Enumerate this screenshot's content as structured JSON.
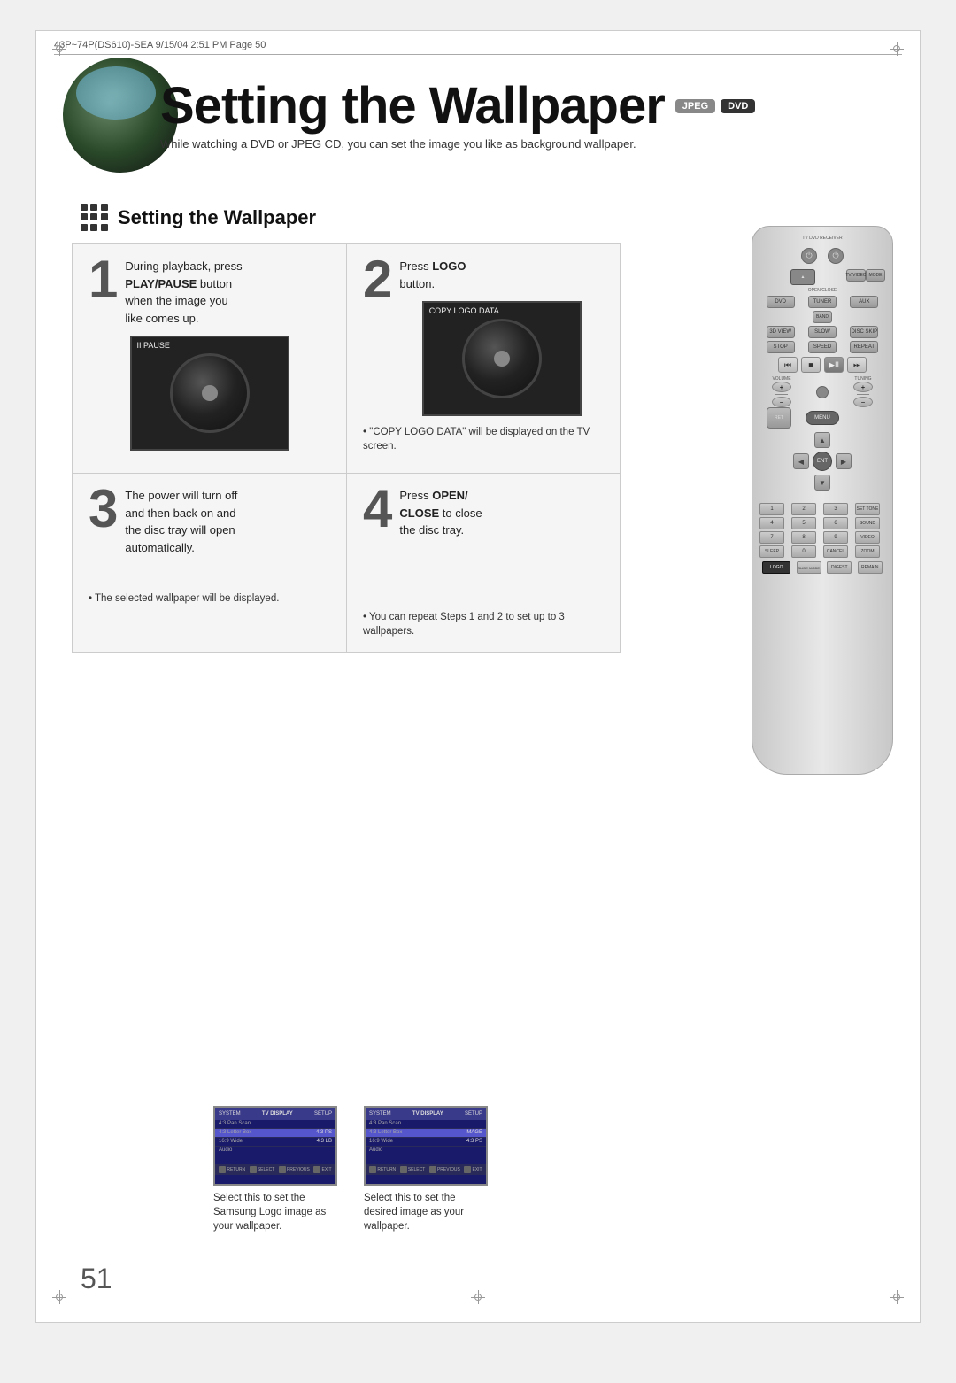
{
  "page": {
    "header": "43P~74P(DS610)-SEA   9/15/04  2:51 PM   Page 50",
    "page_number": "51"
  },
  "title": {
    "main": "Setting the Wallpaper",
    "badges": [
      "JPEG",
      "DVD"
    ],
    "subtitle": "While watching a DVD or JPEG CD, you can set the image you like as background wallpaper."
  },
  "section": {
    "heading": "Setting the Wallpaper"
  },
  "steps": [
    {
      "number": "1",
      "text_line1": "During playback, press",
      "text_bold": "PLAY/PAUSE",
      "text_line2": " button",
      "text_line3": "when the image you",
      "text_line4": "like comes up.",
      "image_label": "II PAUSE"
    },
    {
      "number": "2",
      "text_pre": "Press ",
      "text_bold": "LOGO",
      "text_post": "",
      "text_line2": "button.",
      "bullet": "\"COPY LOGO DATA\" will be displayed on the TV screen.",
      "image_label": "COPY LOGO DATA"
    },
    {
      "number": "3",
      "text_line1": "The power will turn off",
      "text_line2": "and then back on and",
      "text_line3": "the disc tray will open",
      "text_line4": "automatically.",
      "bullet": "The selected wallpaper will be displayed."
    },
    {
      "number": "4",
      "text_pre": "Press ",
      "text_bold1": "OPEN/",
      "text_bold2": "CLOSE",
      "text_post": " to close",
      "text_line2": "the disc tray.",
      "bullet": "You can repeat Steps 1 and 2 to set up to 3 wallpapers."
    }
  ],
  "screenshots": [
    {
      "menu_title": "SETUP",
      "label_left": "SYSTEM",
      "label_right": "TV DISPLAY",
      "rows": [
        {
          "label": "4:3 Pan Scan",
          "value": "",
          "selected": false
        },
        {
          "label": "4:3 Letter Box",
          "value": "4:3 PS",
          "selected": true
        },
        {
          "label": "16:9 Wide",
          "value": "4:3 LB",
          "selected": false
        },
        {
          "label": "Audio",
          "value": "",
          "selected": false
        }
      ],
      "caption": "Select this to set the Samsung Logo image as your wallpaper."
    },
    {
      "menu_title": "SETUP",
      "label_left": "SYSTEM",
      "label_right": "TV DISPLAY",
      "rows": [
        {
          "label": "4:3 Pan Scan",
          "value": "",
          "selected": false
        },
        {
          "label": "4:3 Letter Box",
          "value": "IMAGE",
          "selected": true
        },
        {
          "label": "16:9 Wide",
          "value": "4:3 PS",
          "selected": false
        },
        {
          "label": "Audio",
          "value": "",
          "selected": false
        }
      ],
      "caption": "Select this to set the desired image as your wallpaper."
    }
  ],
  "remote": {
    "labels": {
      "open_close": "OPEN/CLOSE",
      "tv_video": "TV/VIDEO",
      "mode": "MODE",
      "dvd": "DVD",
      "tuner": "TUNER",
      "aux": "AUX",
      "band": "BAND",
      "3d_view": "3D VIEW",
      "slow": "SLOW",
      "disc_skip": "DISC SKIP",
      "stop": "STOP",
      "speed": "SPEED",
      "repeat": "REPEAT",
      "volume": "VOLUME",
      "tuning": "TUNING",
      "menu": "MENU",
      "enter": "ENTER",
      "return": "RETURN",
      "logo": "LOGO",
      "slide_mode": "SLIDE MODE",
      "digest": "DIGEST",
      "remain": "REMAIN"
    }
  }
}
